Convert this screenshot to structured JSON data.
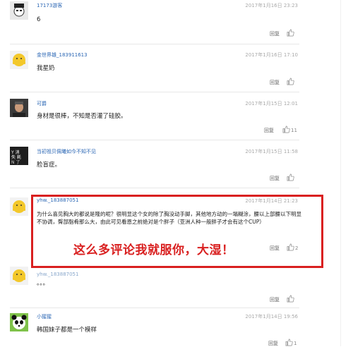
{
  "comments": [
    {
      "user": "17173游客",
      "time": "2017年1月16日 23:23",
      "text": "6",
      "reply": "回复",
      "likes": ""
    },
    {
      "user": "金世界雄_183911613",
      "time": "2017年1月16日 17:10",
      "text": "我星奶",
      "reply": "回复",
      "likes": ""
    },
    {
      "user": "可爵",
      "time": "2017年1月15日 12:01",
      "text": "身材是很棒，不知是否灌了硅胶。",
      "reply": "回复",
      "likes": "11"
    },
    {
      "user": "当初祖贝佩曦如今不知不见",
      "time": "2017年1月15日 11:58",
      "text": "脸盲症。",
      "reply": "回复",
      "likes": ""
    },
    {
      "user": "yhw._183887051",
      "time": "2017年1月14日 21:23",
      "text": "为什么喜见胸大的都说是隆的呢？很明显这个女的除了胸没动手脚，其他地方动的一塌糊涂，腰以上部腰以下明显不协调，臀部脂肴那么大，由此可见看恩之前绝对是个胖子（亚洲人种一般胖子才会有这个CUP）",
      "reply": "回复",
      "likes": "2"
    },
    {
      "user": "yhw._183887051",
      "time": "",
      "text": "。。。",
      "reply": "回复",
      "likes": ""
    },
    {
      "user": "小猩猩",
      "time": "2017年1月14日 19:56",
      "text": "韩国妹子都是一个模样",
      "reply": "回复",
      "likes": "1"
    }
  ],
  "annotation": "这么多评论我就服你，大湿！",
  "colors": {
    "accent_red": "#d92020",
    "username_blue": "#2a66b4"
  }
}
